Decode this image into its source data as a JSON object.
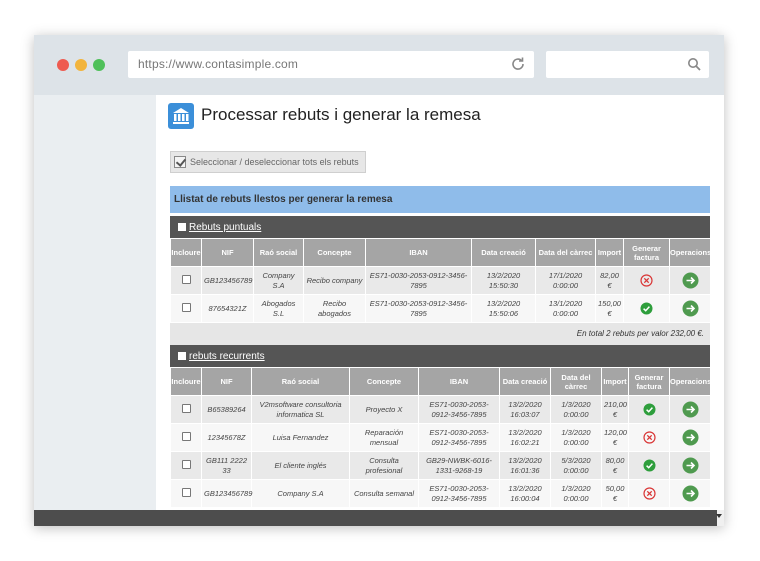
{
  "browser": {
    "url": "https://www.contasimple.com",
    "search_value": ""
  },
  "page": {
    "title": "Processar rebuts i generar la remesa",
    "select_all_label": "Seleccionar / deseleccionar tots els rebuts",
    "list_header": "Llistat de rebuts llestos per generar la remesa"
  },
  "colors": {
    "list_header_bg": "#8fbcea",
    "section_header_bg": "#555555",
    "table_header_bg": "#a5a5a5",
    "ok_green": "#2e9e3c",
    "error_red": "#d93636",
    "operation_green": "#4f9a4f"
  },
  "table_columns": {
    "include": "Incloure",
    "nif": "NIF",
    "name": "Raó social",
    "concept": "Concepte",
    "iban": "IBAN",
    "created": "Data creació",
    "charge_date": "Data del càrrec",
    "amount": "Import",
    "invoice": "Generar factura",
    "operations": "Operacions"
  },
  "puntuals": {
    "title": "Rebuts puntuals",
    "rows": [
      {
        "nif": "GB123456789",
        "name": "Company S.A",
        "concept": "Recibo company",
        "iban": "ES71-0030-2053-0912-3456-7895",
        "created": "13/2/2020 15:50:30",
        "charge": "17/1/2020 0:00:00",
        "amount": "82,00 €",
        "invoice_icon": "error-icon"
      },
      {
        "nif": "87654321Z",
        "name": "Abogados S.L",
        "concept": "Recibo abogados",
        "iban": "ES71-0030-2053-0912-3456-7895",
        "created": "13/2/2020 15:50:06",
        "charge": "13/1/2020 0:00:00",
        "amount": "150,00 €",
        "invoice_icon": "check-icon"
      }
    ],
    "total": "En total 2 rebuts per valor 232,00 €."
  },
  "recurrents": {
    "title": "rebuts recurrents",
    "rows": [
      {
        "nif": "B65389264",
        "name": "V2msoftware consultoria informatica SL",
        "concept": "Proyecto X",
        "iban": "ES71-0030-2053-0912-3456-7895",
        "created": "13/2/2020 16:03:07",
        "charge": "1/3/2020 0:00:00",
        "amount": "210,00 €",
        "invoice_icon": "check-icon"
      },
      {
        "nif": "12345678Z",
        "name": "Luisa Fernandez",
        "concept": "Reparación mensual",
        "iban": "ES71-0030-2053-0912-3456-7895",
        "created": "13/2/2020 16:02:21",
        "charge": "1/3/2020 0:00:00",
        "amount": "120,00 €",
        "invoice_icon": "error-icon"
      },
      {
        "nif": "GB111 2222 33",
        "name": "El cliente inglés",
        "concept": "Consulta profesional",
        "iban": "GB29-NWBK-6016-1331-9268-19",
        "created": "13/2/2020 16:01:36",
        "charge": "5/3/2020 0:00:00",
        "amount": "80,00 €",
        "invoice_icon": "check-icon"
      },
      {
        "nif": "GB123456789",
        "name": "Company S.A",
        "concept": "Consulta semanal",
        "iban": "ES71-0030-2053-0912-3456-7895",
        "created": "13/2/2020 16:00:04",
        "charge": "1/3/2020 0:00:00",
        "amount": "50,00 €",
        "invoice_icon": "error-icon"
      }
    ]
  }
}
